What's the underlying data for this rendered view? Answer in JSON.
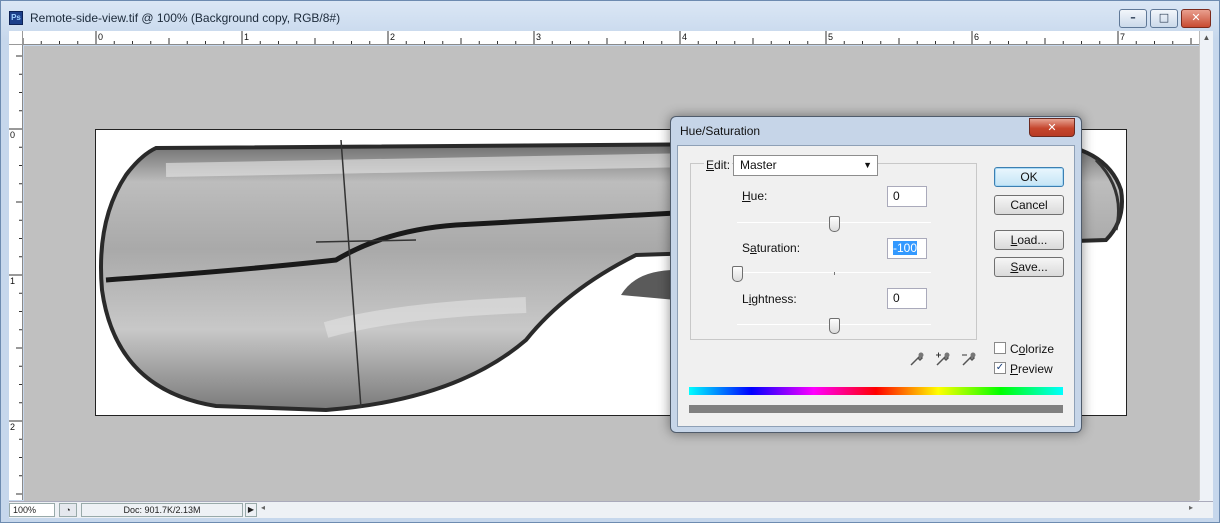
{
  "window": {
    "title": "Remote-side-view.tif @ 100% (Background copy, RGB/8#)",
    "app_icon_text": "Ps",
    "controls": {
      "minimize": "–",
      "maximize": "□",
      "close": "✕"
    }
  },
  "rulers": {
    "horizontal_labels": [
      "0",
      "1",
      "2",
      "3",
      "4",
      "5",
      "6",
      "7"
    ],
    "vertical_labels": [
      "0",
      "1",
      "2"
    ]
  },
  "statusbar": {
    "zoom": "100%",
    "doc_info": "Doc: 901.7K/2.13M",
    "arrow": "▶",
    "scroll_left": "◂",
    "scroll_right": "▸"
  },
  "dialog": {
    "title": "Hue/Saturation",
    "close": "✕",
    "edit": {
      "label_u": "E",
      "label_rest": "dit:",
      "value": "Master"
    },
    "hue": {
      "label_u": "H",
      "label_rest": "ue:",
      "value": "0"
    },
    "saturation": {
      "label_pre": "S",
      "label_u": "a",
      "label_rest": "turation:",
      "value": "-100"
    },
    "lightness": {
      "label_pre": "L",
      "label_u": "i",
      "label_rest": "ghtness:",
      "value": "0"
    },
    "buttons": {
      "ok": "OK",
      "cancel": "Cancel",
      "load_u": "L",
      "load_rest": "oad...",
      "save_u": "S",
      "save_rest": "ave..."
    },
    "colorize": {
      "label_pre": "C",
      "label_u": "o",
      "label_rest": "lorize",
      "checked": false
    },
    "preview": {
      "label_u": "P",
      "label_rest": "review",
      "checked": true
    },
    "sliders": {
      "hue_level": 0.5,
      "saturation_level": 0.0,
      "lightness_level": 0.5
    },
    "eyedroppers": [
      "eyedropper-icon",
      "eyedropper-plus-icon",
      "eyedropper-minus-icon"
    ]
  },
  "colors": {
    "canvas_gray": "#c0c0c0",
    "window_chrome": "#c6d7ec",
    "selection": "#3399ff"
  }
}
